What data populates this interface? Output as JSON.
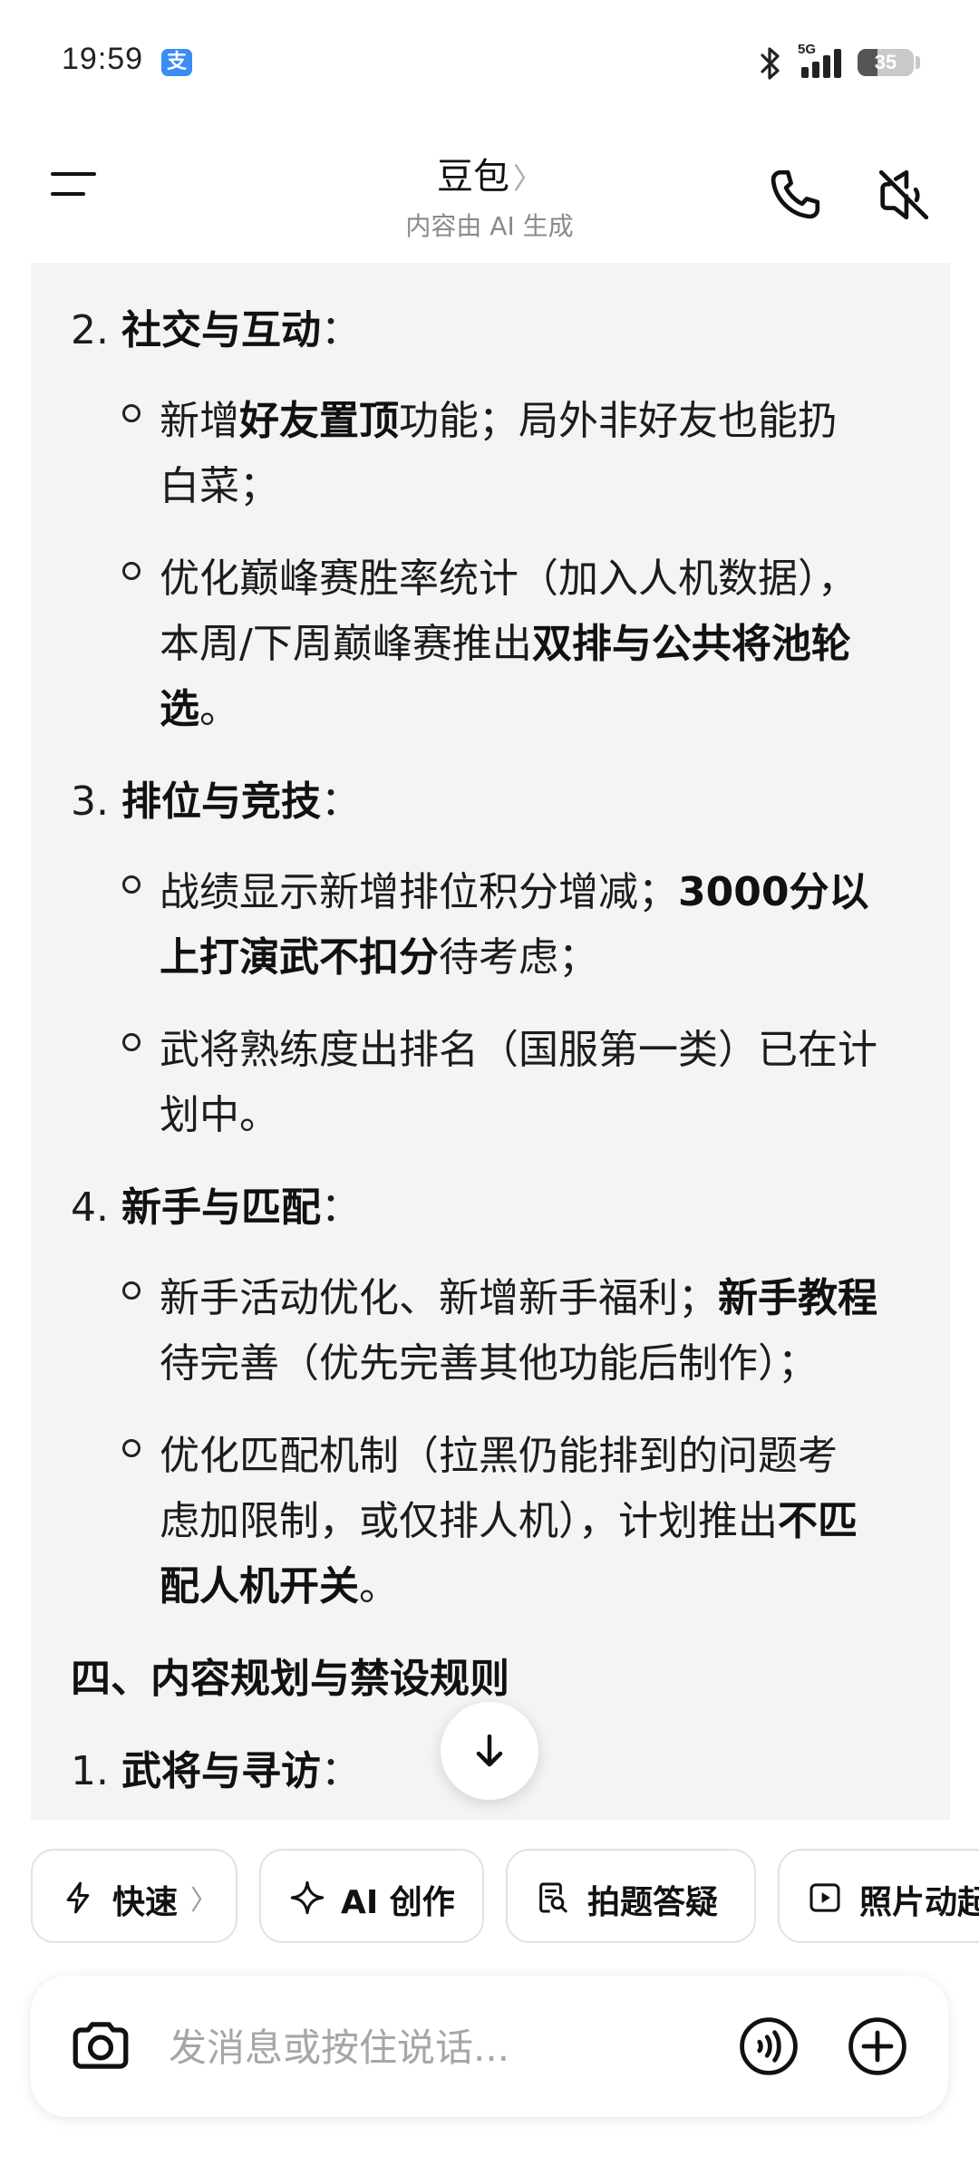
{
  "status_bar": {
    "time": "19:59",
    "app_badge": "支",
    "network": "5G",
    "battery": 35,
    "battery_label": "35"
  },
  "header": {
    "title": "豆包",
    "title_chevron": "〉",
    "subtitle": "内容由 AI 生成"
  },
  "content": {
    "lines": [
      [
        {
          "t": "2. "
        },
        {
          "t": "社交与互动",
          "b": true
        },
        {
          "t": "："
        }
      ],
      [
        {
          "t": "新增"
        },
        {
          "t": "好友置顶",
          "b": true
        },
        {
          "t": "功能；局外非好友也能扔"
        }
      ],
      [
        {
          "t": "白菜；"
        }
      ],
      [
        {
          "t": "优化巅峰赛胜率统计（加入人机数据），"
        }
      ],
      [
        {
          "t": "本周/下周巅峰赛推出"
        },
        {
          "t": "双排与公共将池轮",
          "b": true
        }
      ],
      [
        {
          "t": "选",
          "b": true
        },
        {
          "t": "。"
        }
      ],
      [
        {
          "t": "3. "
        },
        {
          "t": "排位与竞技",
          "b": true
        },
        {
          "t": "："
        }
      ],
      [
        {
          "t": "战绩显示新增排位积分增减；"
        },
        {
          "t": "3000分以",
          "b": true
        }
      ],
      [
        {
          "t": "上打演武不扣分",
          "b": true
        },
        {
          "t": "待考虑；"
        }
      ],
      [
        {
          "t": "武将熟练度出排名（国服第一类）已在计"
        }
      ],
      [
        {
          "t": "划中。"
        }
      ],
      [
        {
          "t": "4. "
        },
        {
          "t": "新手与匹配",
          "b": true
        },
        {
          "t": "："
        }
      ],
      [
        {
          "t": "新手活动优化、新增新手福利；"
        },
        {
          "t": "新手教程",
          "b": true
        }
      ],
      [
        {
          "t": "待完善（优先完善其他功能后制作）；"
        }
      ],
      [
        {
          "t": "优化匹配机制（拉黑仍能排到的问题考"
        }
      ],
      [
        {
          "t": "虑加限制，或仅排人机），计划推出"
        },
        {
          "t": "不匹",
          "b": true
        }
      ],
      [
        {
          "t": "配人机开关",
          "b": true
        },
        {
          "t": "。"
        }
      ],
      [
        {
          "t": "四、内容规划与禁设规则",
          "b": true
        }
      ],
      [
        {
          "t": "1. "
        },
        {
          "t": "武将与寻访",
          "b": true
        },
        {
          "t": "："
        }
      ]
    ]
  },
  "quick_actions": [
    {
      "icon": "lightning-icon",
      "label": "快速",
      "chevron": "〉"
    },
    {
      "icon": "sparkle-icon",
      "label": "AI 创作"
    },
    {
      "icon": "search-document-icon",
      "label": "拍题答疑"
    },
    {
      "icon": "play-icon",
      "label": "照片动起来"
    }
  ],
  "input": {
    "placeholder": "发消息或按住说话..."
  }
}
